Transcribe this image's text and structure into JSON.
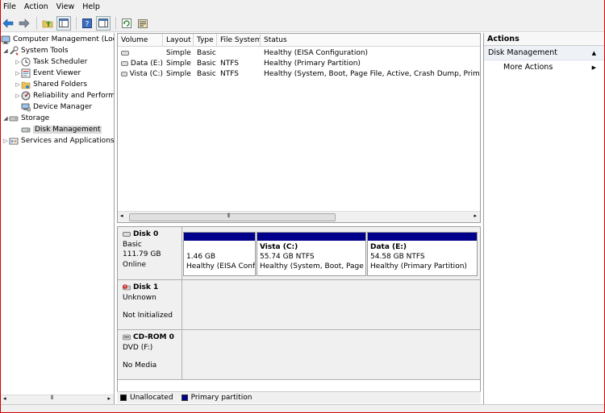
{
  "menu": [
    "File",
    "Action",
    "View",
    "Help"
  ],
  "toolbar": {
    "icons": [
      "back-arrow-icon",
      "forward-arrow-icon",
      "up-folder-icon",
      "console-tree-icon",
      "help-icon",
      "action-pane-icon",
      "refresh-icon",
      "properties-icon"
    ]
  },
  "tree": {
    "root": "Computer Management (Local",
    "system_tools": "System Tools",
    "task_scheduler": "Task Scheduler",
    "event_viewer": "Event Viewer",
    "shared_folders": "Shared Folders",
    "reliability": "Reliability and Performa",
    "device_manager": "Device Manager",
    "storage": "Storage",
    "disk_management": "Disk Management",
    "services": "Services and Applications"
  },
  "volumes": {
    "columns": [
      "Volume",
      "Layout",
      "Type",
      "File System",
      "Status"
    ],
    "rows": [
      {
        "volume": "",
        "layout": "Simple",
        "type": "Basic",
        "fs": "",
        "status": "Healthy (EISA Configuration)"
      },
      {
        "volume": "Data (E:)",
        "layout": "Simple",
        "type": "Basic",
        "fs": "NTFS",
        "status": "Healthy (Primary Partition)"
      },
      {
        "volume": "Vista (C:)",
        "layout": "Simple",
        "type": "Basic",
        "fs": "NTFS",
        "status": "Healthy (System, Boot, Page File, Active, Crash Dump, Primary Par"
      }
    ]
  },
  "disks": {
    "disk0": {
      "name": "Disk 0",
      "type": "Basic",
      "size": "111.79 GB",
      "state": "Online"
    },
    "disk1": {
      "name": "Disk 1",
      "type": "Unknown",
      "state": "Not Initialized"
    },
    "cdrom0": {
      "name": "CD-ROM 0",
      "type": "DVD (F:)",
      "state": "No Media"
    },
    "partitions": [
      {
        "name": "",
        "size": "1.46 GB",
        "status": "Healthy (EISA Confi"
      },
      {
        "name": "Vista  (C:)",
        "size": "55.74 GB NTFS",
        "status": "Healthy (System, Boot, Page Fi"
      },
      {
        "name": "Data  (E:)",
        "size": "54.58 GB NTFS",
        "status": "Healthy (Primary Partition)"
      }
    ]
  },
  "legend": {
    "unallocated": "Unallocated",
    "primary": "Primary partition"
  },
  "actions": {
    "title": "Actions",
    "section": "Disk Management",
    "more": "More Actions"
  },
  "colors": {
    "partition_bar": "#00008b",
    "unallocated": "#000000",
    "primary": "#00008b"
  }
}
